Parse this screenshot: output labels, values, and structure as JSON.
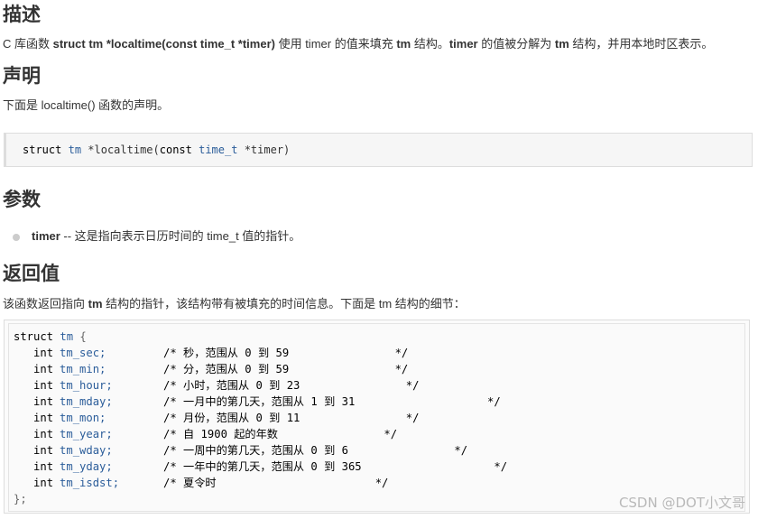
{
  "sections": {
    "describe": {
      "heading": "描述",
      "text_prefix": "C 库函数 ",
      "signature": "struct tm *localtime(const time_t *timer)",
      "text_mid1": " 使用 timer 的值来填充 ",
      "tm1": "tm",
      "text_mid2": " 结构。",
      "timer_word": "timer",
      "text_mid3": " 的值被分解为 ",
      "tm2": "tm",
      "text_suffix": " 结构，并用本地时区表示。"
    },
    "declaration": {
      "heading": "声明",
      "text": "下面是 localtime() 函数的声明。",
      "code": {
        "kw_struct": "struct",
        "type_tm": "tm",
        "star_fn": " *localtime(",
        "kw_const": "const",
        "type_time_t": "time_t",
        "rest": " *timer)"
      }
    },
    "parameters": {
      "heading": "参数",
      "items": [
        {
          "name": "timer",
          "desc": " -- 这是指向表示日历时间的 time_t 值的指针。"
        }
      ]
    },
    "return_value": {
      "heading": "返回值",
      "text_prefix": "该函数返回指向 ",
      "tm": "tm",
      "text_suffix": " 结构的指针，该结构带有被填充的时间信息。下面是 tm 结构的细节：",
      "code": {
        "open_kw": "struct",
        "open_name": "tm",
        "open_brace": " {",
        "fields": [
          {
            "type": "int",
            "name": "tm_sec;",
            "comment": "/* 秒，范围从 0 到 59                */"
          },
          {
            "type": "int",
            "name": "tm_min;",
            "comment": "/* 分，范围从 0 到 59                */"
          },
          {
            "type": "int",
            "name": "tm_hour;",
            "comment": "/* 小时，范围从 0 到 23                */"
          },
          {
            "type": "int",
            "name": "tm_mday;",
            "comment": "/* 一月中的第几天，范围从 1 到 31                    */"
          },
          {
            "type": "int",
            "name": "tm_mon;",
            "comment": "/* 月份，范围从 0 到 11                */"
          },
          {
            "type": "int",
            "name": "tm_year;",
            "comment": "/* 自 1900 起的年数                */"
          },
          {
            "type": "int",
            "name": "tm_wday;",
            "comment": "/* 一周中的第几天，范围从 0 到 6                */"
          },
          {
            "type": "int",
            "name": "tm_yday;",
            "comment": "/* 一年中的第几天，范围从 0 到 365                    */"
          },
          {
            "type": "int",
            "name": "tm_isdst;",
            "comment": "/* 夏令时                        */"
          }
        ],
        "close": "};"
      }
    }
  },
  "watermark": "CSDN @DOT小文哥"
}
